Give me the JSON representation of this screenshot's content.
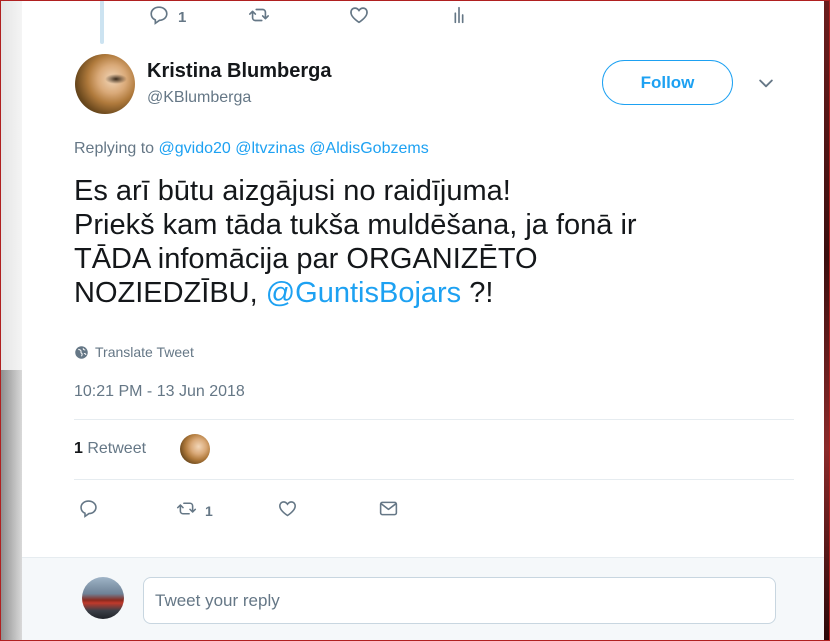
{
  "top_actions": {
    "reply_count": "1",
    "retweet_count": "",
    "like_count": ""
  },
  "author": {
    "name": "Kristina Blumberga",
    "handle": "@KBlumberga"
  },
  "follow_label": "Follow",
  "replying": {
    "prefix": "Replying to",
    "mentions": [
      "@gvido20",
      "@ltvzinas",
      "@AldisGobzems"
    ]
  },
  "tweet": {
    "line1": "Es arī būtu aizgājusi no raidījuma!",
    "line2": "Priekš  kam tāda tukša muldēšana, ja fonā ir",
    "line3": "TĀDA infomācija par ORGANIZĒTO",
    "line4_text": "NOZIEDZĪBU, ",
    "line4_mention": "@GuntisBojars",
    "line4_tail": " ?!"
  },
  "translate_label": "Translate Tweet",
  "timestamp": "10:21 PM - 13 Jun 2018",
  "stats": {
    "retweet_number": "1",
    "retweet_label": " Retweet"
  },
  "bottom_actions": {
    "retweet_count": "1"
  },
  "reply_box": {
    "placeholder": "Tweet your reply"
  },
  "colors": {
    "accent": "#1da1f2",
    "secondary_text": "#657786",
    "primary_text": "#14171a"
  },
  "icons": {
    "reply": "reply-icon",
    "retweet": "retweet-icon",
    "like": "heart-icon",
    "analytics": "analytics-icon",
    "dm": "envelope-icon",
    "translate": "globe-icon",
    "more": "chevron-down-icon"
  }
}
